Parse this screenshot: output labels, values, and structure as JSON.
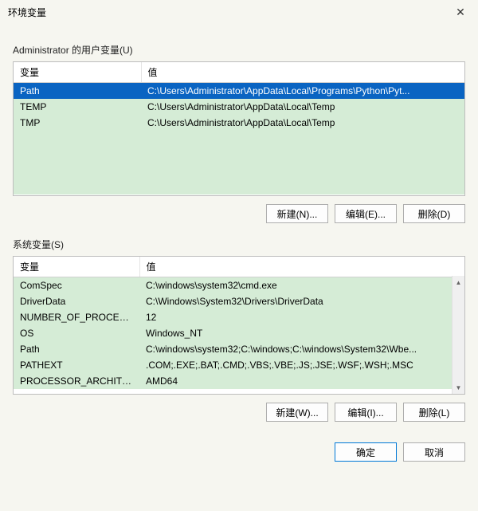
{
  "window": {
    "title": "环境变量",
    "close_glyph": "✕"
  },
  "user_vars": {
    "label": "Administrator 的用户变量(U)",
    "columns": {
      "name": "变量",
      "value": "值"
    },
    "rows": [
      {
        "name": "Path",
        "value": "C:\\Users\\Administrator\\AppData\\Local\\Programs\\Python\\Pyt...",
        "selected": true
      },
      {
        "name": "TEMP",
        "value": "C:\\Users\\Administrator\\AppData\\Local\\Temp",
        "selected": false
      },
      {
        "name": "TMP",
        "value": "C:\\Users\\Administrator\\AppData\\Local\\Temp",
        "selected": false
      }
    ],
    "buttons": {
      "new": "新建(N)...",
      "edit": "编辑(E)...",
      "delete": "删除(D)"
    }
  },
  "system_vars": {
    "label": "系统变量(S)",
    "columns": {
      "name": "变量",
      "value": "值"
    },
    "rows": [
      {
        "name": "ComSpec",
        "value": "C:\\windows\\system32\\cmd.exe"
      },
      {
        "name": "DriverData",
        "value": "C:\\Windows\\System32\\Drivers\\DriverData"
      },
      {
        "name": "NUMBER_OF_PROCESSORS",
        "value": "12"
      },
      {
        "name": "OS",
        "value": "Windows_NT"
      },
      {
        "name": "Path",
        "value": "C:\\windows\\system32;C:\\windows;C:\\windows\\System32\\Wbe..."
      },
      {
        "name": "PATHEXT",
        "value": ".COM;.EXE;.BAT;.CMD;.VBS;.VBE;.JS;.JSE;.WSF;.WSH;.MSC"
      },
      {
        "name": "PROCESSOR_ARCHITECT...",
        "value": "AMD64"
      }
    ],
    "buttons": {
      "new": "新建(W)...",
      "edit": "编辑(I)...",
      "delete": "删除(L)"
    }
  },
  "footer": {
    "ok": "确定",
    "cancel": "取消"
  },
  "scroll": {
    "up": "▲",
    "down": "▼"
  }
}
